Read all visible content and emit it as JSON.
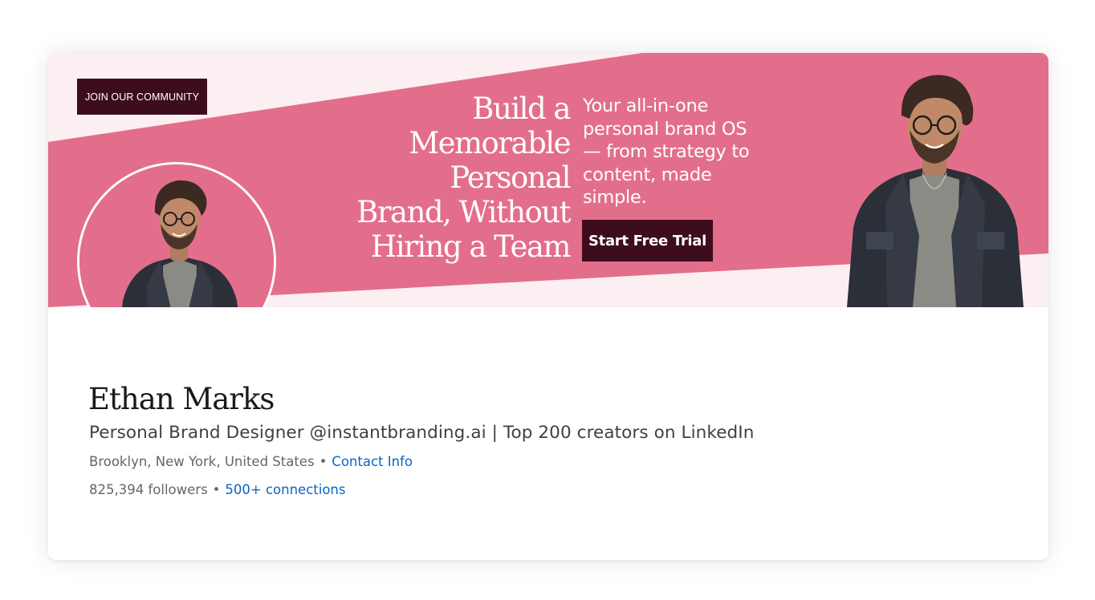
{
  "banner": {
    "community_button": "JOIN OUR COMMUNITY",
    "headline_lines": [
      "Build a",
      "Memorable",
      "Personal",
      "Brand, Without",
      "Hiring a Team"
    ],
    "tagline_lines": [
      "Your all-in-one",
      "personal brand OS",
      "— from strategy to",
      "content, made",
      "simple."
    ],
    "cta_button": "Start Free Trial"
  },
  "profile": {
    "name": "Ethan Marks",
    "headline": "Personal Brand Designer @instantbranding.ai | Top 200 creators on LinkedIn",
    "location": "Brooklyn, New York, United States",
    "contact_link": "Contact Info",
    "followers": "825,394 followers",
    "connections_link": "500+ connections",
    "separator": "•"
  },
  "colors": {
    "banner_pink": "#e36e8b",
    "banner_light": "#fbeff1",
    "button_dark": "#3d0c1f",
    "link_blue": "#0a66c2"
  },
  "icons": {
    "avatar": "person-photo",
    "banner_photo": "person-photo"
  }
}
